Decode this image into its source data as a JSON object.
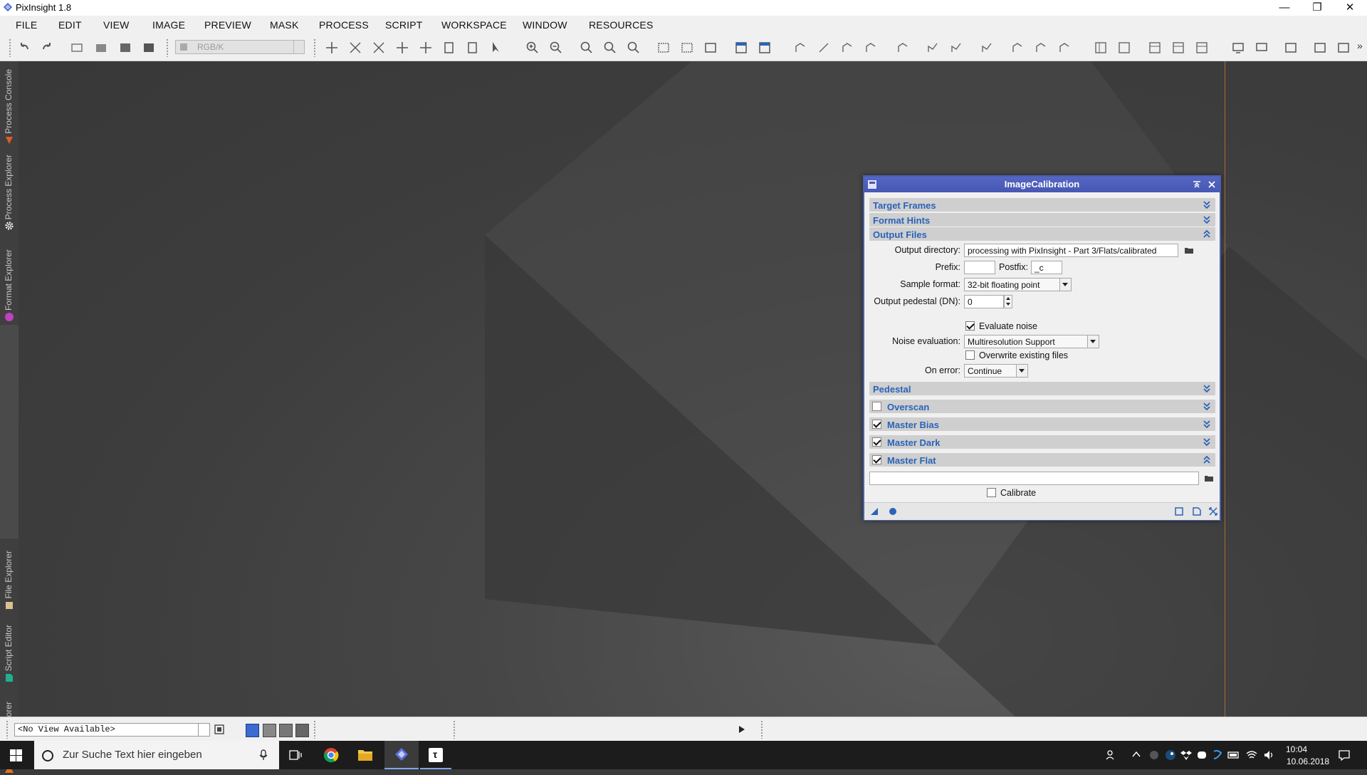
{
  "window": {
    "title": "PixInsight 1.8"
  },
  "menu": [
    "FILE",
    "EDIT",
    "VIEW",
    "IMAGE",
    "PREVIEW",
    "MASK",
    "PROCESS",
    "SCRIPT",
    "WORKSPACE",
    "WINDOW",
    "RESOURCES"
  ],
  "toolbar": {
    "color_space_select": "RGB/K"
  },
  "sidebar": {
    "tabs": [
      {
        "label": "Process Console",
        "icon": "process-console-icon",
        "color": "#e05a2a"
      },
      {
        "label": "Process Explorer",
        "icon": "gear-icon",
        "color": "#ffffff"
      },
      {
        "label": "Format Explorer",
        "icon": "format-icon",
        "color": "#c040c0"
      },
      {
        "label": "File Explorer",
        "icon": "file-icon",
        "color": "#d8c090"
      },
      {
        "label": "Script Editor",
        "icon": "script-icon",
        "color": "#20b090"
      },
      {
        "label": "History Explorer",
        "icon": "history-icon",
        "color": "#e07020"
      }
    ]
  },
  "dialog": {
    "title": "ImageCalibration",
    "sections": {
      "target_frames": "Target Frames",
      "format_hints": "Format Hints",
      "output_files": "Output Files",
      "pedestal": "Pedestal",
      "overscan": "Overscan",
      "master_bias": "Master Bias",
      "master_dark": "Master Dark",
      "master_flat": "Master Flat"
    },
    "section_checks": {
      "overscan": false,
      "master_bias": true,
      "master_dark": true,
      "master_flat": true
    },
    "output": {
      "directory_label": "Output directory:",
      "directory_value": "processing with PixInsight - Part 3/Flats/calibrated",
      "prefix_label": "Prefix:",
      "prefix_value": "",
      "postfix_label": "Postfix:",
      "postfix_value": "_c",
      "sample_format_label": "Sample format:",
      "sample_format_value": "32-bit floating point",
      "pedestal_label": "Output pedestal (DN):",
      "pedestal_value": "0",
      "evaluate_noise_label": "Evaluate noise",
      "evaluate_noise_checked": true,
      "noise_eval_label": "Noise evaluation:",
      "noise_eval_value": "Multiresolution Support",
      "overwrite_label": "Overwrite existing files",
      "overwrite_checked": false,
      "on_error_label": "On error:",
      "on_error_value": "Continue"
    },
    "master_flat": {
      "path_value": "",
      "calibrate_label": "Calibrate",
      "calibrate_checked": false
    }
  },
  "statusbar": {
    "view_select": "<No View Available>"
  },
  "taskbar": {
    "search_placeholder": "Zur Suche Text hier eingeben",
    "time": "10:04",
    "date": "10.06.2018"
  }
}
